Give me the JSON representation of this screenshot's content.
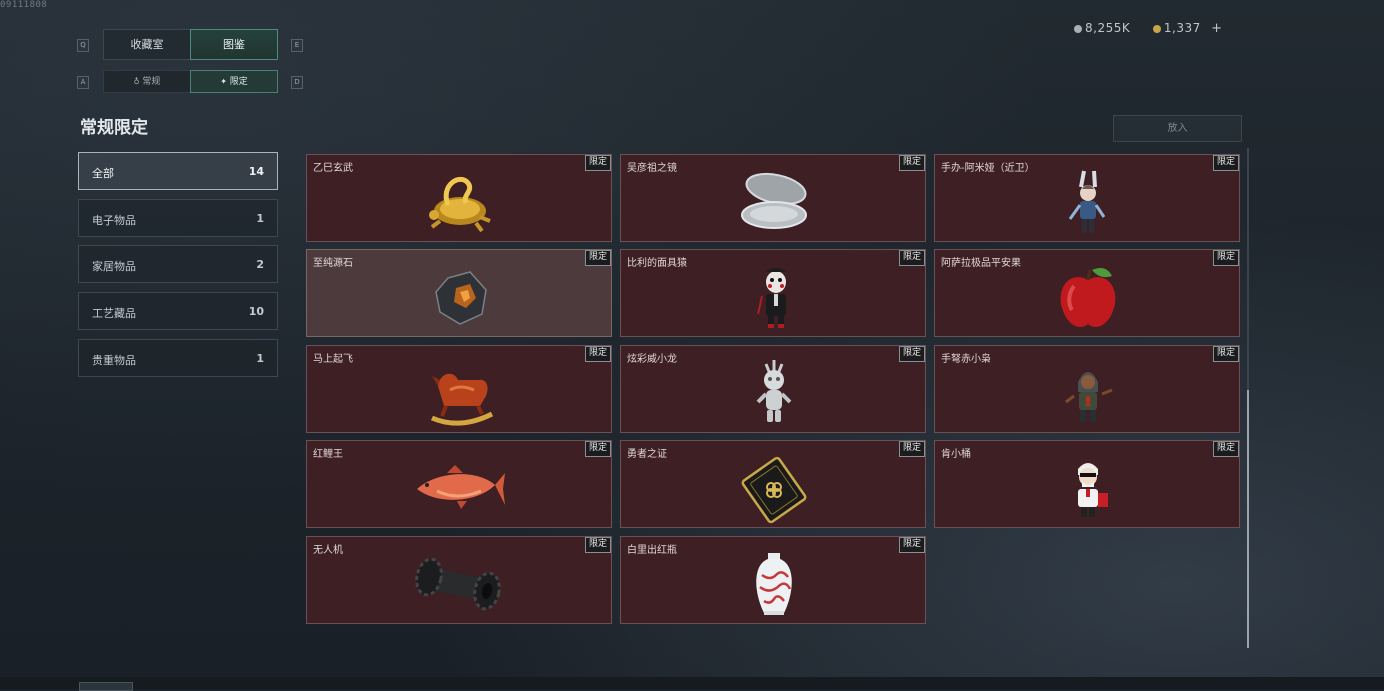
{
  "corner_code": "09111808",
  "tabs": [
    {
      "label": "收藏室",
      "active": false
    },
    {
      "label": "图鉴",
      "active": true
    }
  ],
  "tab_keys": {
    "left": "Q",
    "right": "E"
  },
  "subtabs": [
    {
      "label": "常规",
      "active": false
    },
    {
      "label": "限定",
      "active": true
    }
  ],
  "subtab_keys": {
    "left": "A",
    "right": "D"
  },
  "page_title": "常规限定",
  "categories": [
    {
      "label": "全部",
      "count": "14",
      "active": true
    },
    {
      "label": "电子物品",
      "count": "1"
    },
    {
      "label": "家居物品",
      "count": "2"
    },
    {
      "label": "工艺藏品",
      "count": "10"
    },
    {
      "label": "贵重物品",
      "count": "1"
    }
  ],
  "currency": {
    "silver": "8,255K",
    "gold": "1,337",
    "add": "+"
  },
  "place_button": "放入",
  "items": [
    {
      "name": "乙巳玄武",
      "badge": "限定",
      "icon": "golden-snake-turtle-icon"
    },
    {
      "name": "吴彦祖之镜",
      "badge": "限定",
      "icon": "compact-mirror-icon"
    },
    {
      "name": "手办-阿米娅（近卫）",
      "badge": "限定",
      "icon": "amiya-figure-icon"
    },
    {
      "name": "至纯源石",
      "badge": "限定",
      "icon": "originium-stone-icon"
    },
    {
      "name": "比利的面具猿",
      "badge": "限定",
      "icon": "billy-puppet-icon"
    },
    {
      "name": "阿萨拉极品平安果",
      "badge": "限定",
      "icon": "red-apple-icon"
    },
    {
      "name": "马上起飞",
      "badge": "限定",
      "icon": "rocking-horse-icon"
    },
    {
      "name": "炫彩威小龙",
      "badge": "限定",
      "icon": "silver-dragon-figure-icon"
    },
    {
      "name": "手弩赤小枭",
      "badge": "限定",
      "icon": "crossbow-figure-icon"
    },
    {
      "name": "红鲤王",
      "badge": "限定",
      "icon": "red-carp-icon"
    },
    {
      "name": "勇者之证",
      "badge": "限定",
      "icon": "hero-card-icon"
    },
    {
      "name": "肯小桶",
      "badge": "限定",
      "icon": "colonel-figure-icon"
    },
    {
      "name": "无人机",
      "badge": "限定",
      "icon": "drone-part-icon"
    },
    {
      "name": "白里出红瓶",
      "badge": "限定",
      "icon": "porcelain-vase-icon"
    }
  ]
}
